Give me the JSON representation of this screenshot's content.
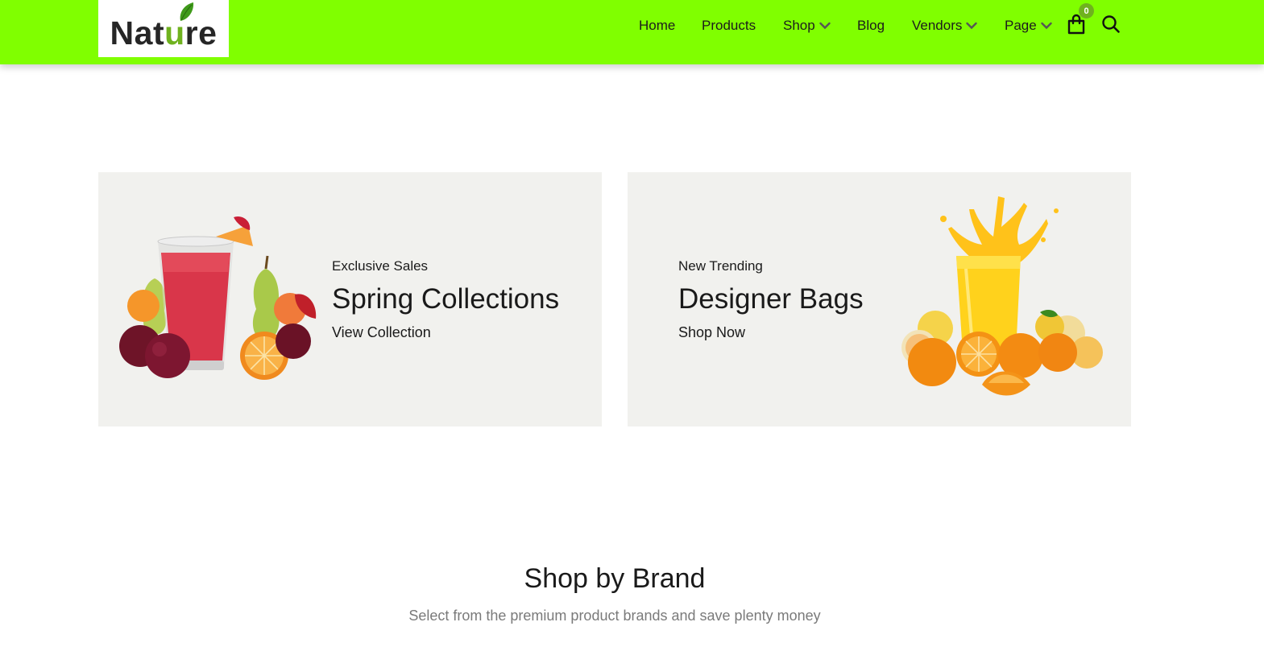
{
  "brand": {
    "logo_text_before": "Nat",
    "logo_text_accent": "u",
    "logo_text_after": "re",
    "accent_color": "#6fb21e",
    "header_color": "#80ff00"
  },
  "nav": {
    "home": "Home",
    "products": "Products",
    "shop": "Shop",
    "blog": "Blog",
    "vendors": "Vendors",
    "page": "Page",
    "cart_count": "0"
  },
  "banners": [
    {
      "eyebrow": "Exclusive Sales",
      "title": "Spring Collections",
      "link": "View Collection",
      "image": "fruit-smoothie-illustration"
    },
    {
      "eyebrow": "New Trending",
      "title": "Designer Bags",
      "link": "Shop Now",
      "image": "orange-juice-illustration"
    }
  ],
  "section": {
    "title": "Shop by Brand",
    "subtitle": "Select from the premium product brands and save plenty money"
  }
}
